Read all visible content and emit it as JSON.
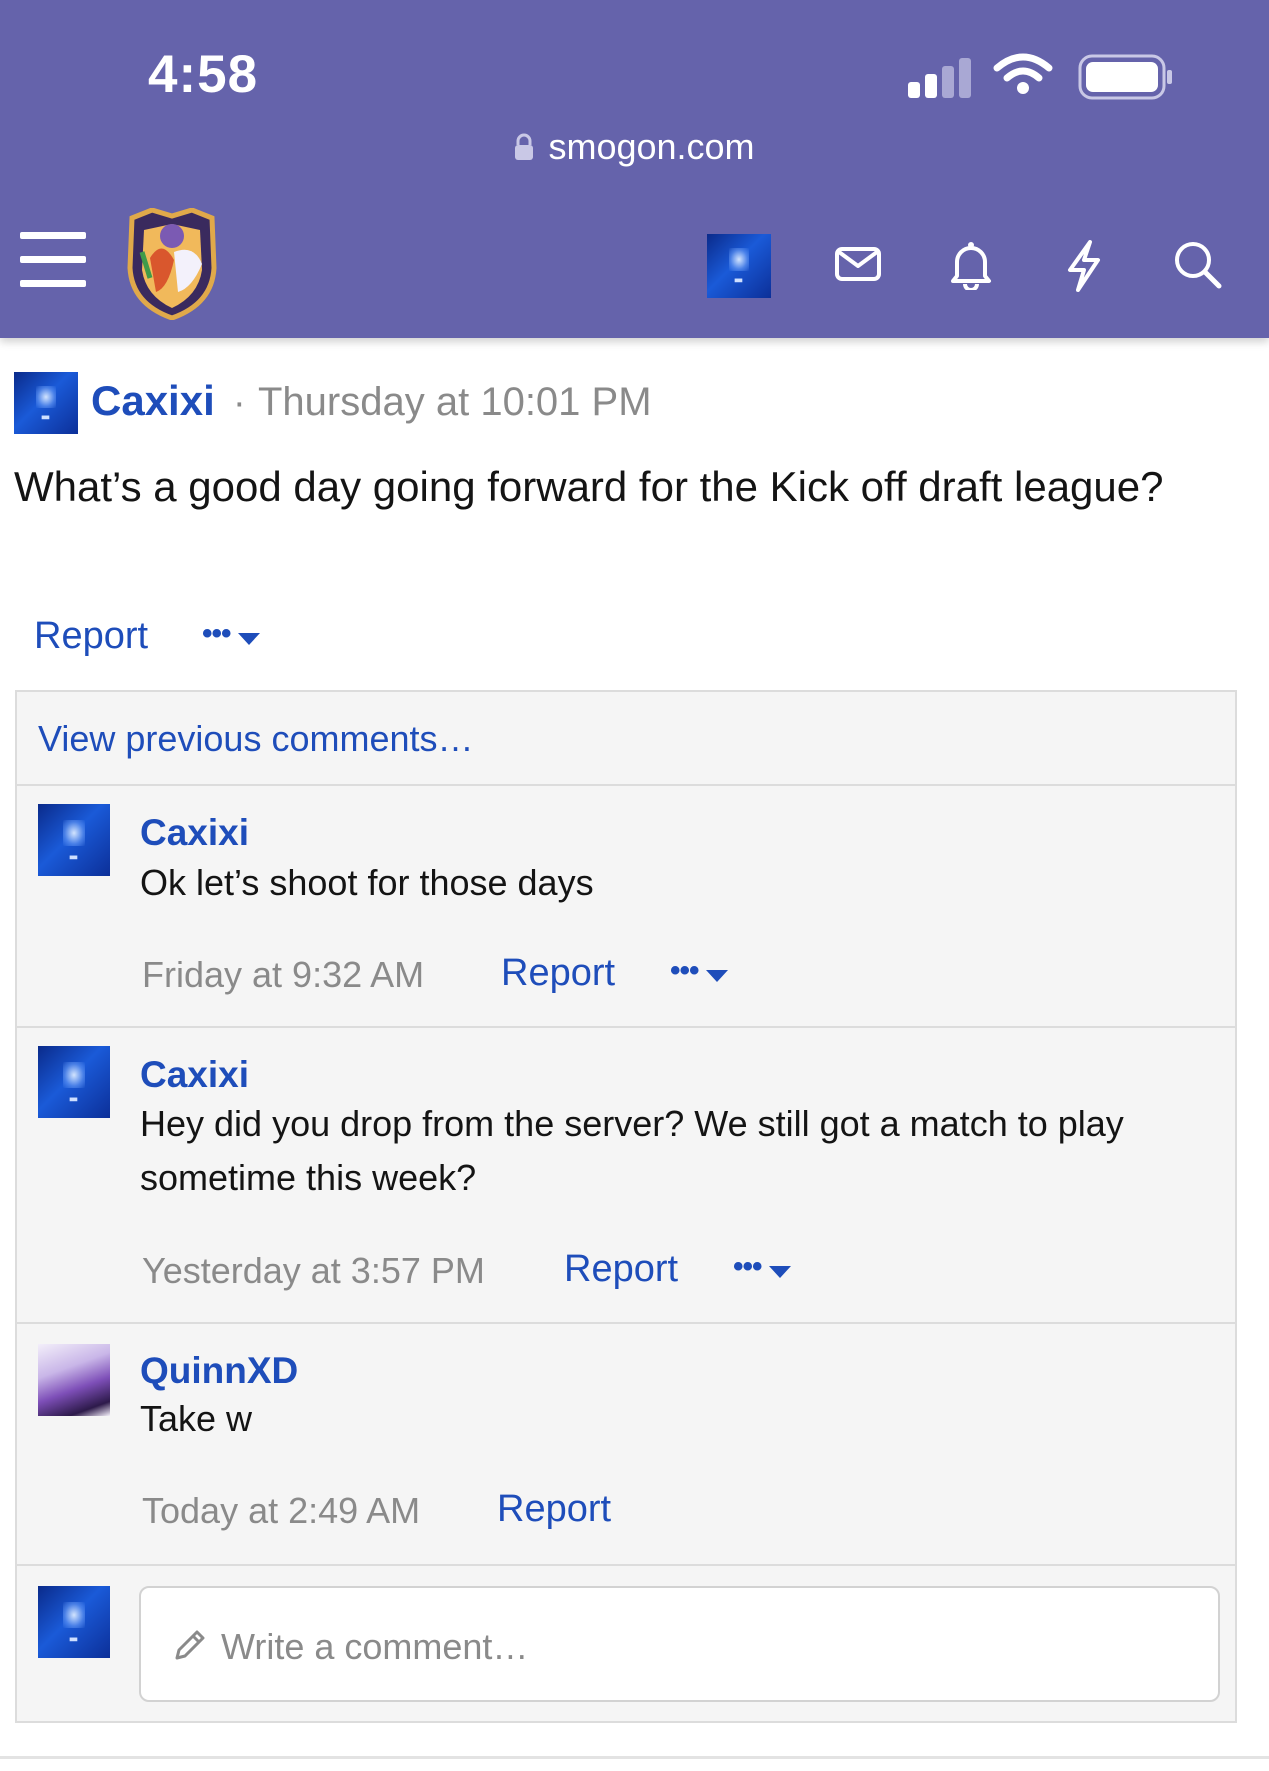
{
  "status_bar": {
    "time": "4:58",
    "url": "smogon.com"
  },
  "colors": {
    "header_bg": "#6563ab",
    "link_blue": "#1e4dba",
    "muted_text": "#8a8a8a",
    "comments_bg": "#f5f5f5"
  },
  "nav": {
    "icons": [
      "menu-icon",
      "site-logo",
      "user-avatar",
      "mail-icon",
      "bell-icon",
      "lightning-icon",
      "search-icon"
    ]
  },
  "post": {
    "author": "Caxixi",
    "separator": "·",
    "time": "Thursday at 10:01 PM",
    "body": "What’s a good day going forward for the Kick off draft league?",
    "report_label": "Report",
    "more_label": "•••"
  },
  "comments": {
    "view_previous": "View previous comments…",
    "items": [
      {
        "author": "Caxixi",
        "text": "Ok let’s shoot for those days",
        "time": "Friday at 9:32 AM",
        "report_label": "Report",
        "more_label": "•••"
      },
      {
        "author": "Caxixi",
        "text": "Hey did you drop from the server? We still got a match to play sometime this week?",
        "time": "Yesterday at 3:57 PM",
        "report_label": "Report",
        "more_label": "•••"
      },
      {
        "author": "QuinnXD",
        "text": "Take w",
        "time": "Today at 2:49 AM",
        "report_label": "Report"
      }
    ],
    "write_placeholder": "Write a comment…"
  }
}
